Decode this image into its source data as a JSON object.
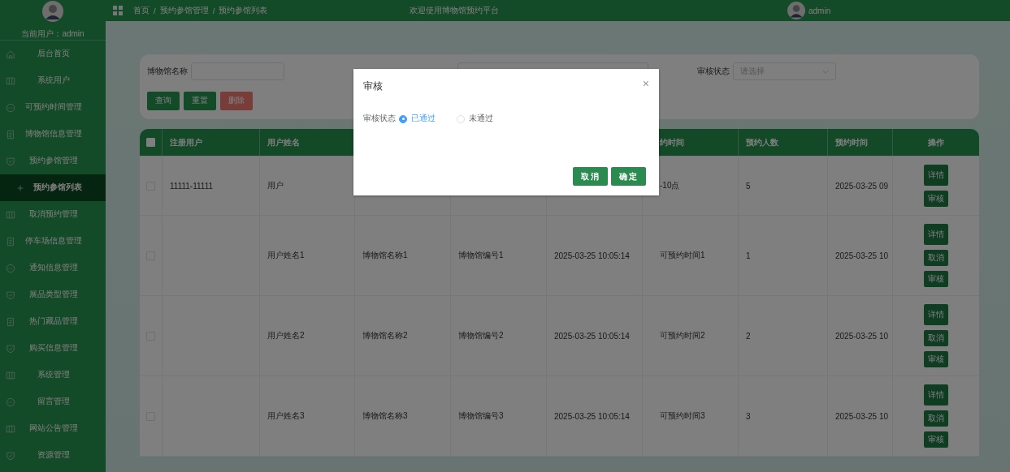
{
  "sidebar": {
    "current_user": "当前用户：admin",
    "items": [
      {
        "label": "后台首页",
        "selected": false
      },
      {
        "label": "系统用户",
        "selected": false
      },
      {
        "label": "可预约时间管理",
        "selected": false
      },
      {
        "label": "博物馆信息管理",
        "selected": false
      },
      {
        "label": "预约参馆管理",
        "selected": false
      },
      {
        "label": "预约参馆列表",
        "selected": true
      },
      {
        "label": "取消预约管理",
        "selected": false
      },
      {
        "label": "停车场信息管理",
        "selected": false
      },
      {
        "label": "通知信息管理",
        "selected": false
      },
      {
        "label": "展品类型管理",
        "selected": false
      },
      {
        "label": "热门藏品管理",
        "selected": false
      },
      {
        "label": "购买信息管理",
        "selected": false
      },
      {
        "label": "系统管理",
        "selected": false
      },
      {
        "label": "留言管理",
        "selected": false
      },
      {
        "label": "网站公告管理",
        "selected": false
      },
      {
        "label": "资源管理",
        "selected": false
      }
    ]
  },
  "topbar": {
    "breadcrumb": [
      "首页",
      "预约参馆管理",
      "预约参馆列表"
    ],
    "separator": "/",
    "welcome": "欢迎使用博物馆预约平台",
    "user": "admin"
  },
  "search": {
    "museum_label": "博物馆名称",
    "status_label": "审核状态",
    "status_placeholder": "请选择",
    "buttons": [
      {
        "label": "查询",
        "kind": "normal"
      },
      {
        "label": "重置",
        "kind": "normal"
      },
      {
        "label": "删除",
        "kind": "danger"
      }
    ]
  },
  "table": {
    "select_all_checked": false,
    "columns": {
      "registered_user": "注册用户",
      "user_name": "用户姓名",
      "slot": "约时间",
      "count": "预约人数",
      "booked_at": "预约时间",
      "actions": "操作"
    },
    "rows": [
      {
        "checked": false,
        "registered_user": "11111-11111",
        "user_name": "用户",
        "slot": "-10点",
        "count": "5",
        "booked_at": "2025-03-25 09",
        "actions": [
          {
            "label": "详情",
            "kind": "large"
          },
          {
            "label": "审核",
            "kind": "small"
          }
        ]
      },
      {
        "checked": false,
        "user_name": "用户姓名1",
        "museum_name": "博物馆名称1",
        "museum_no": "博物馆编号1",
        "time": "2025-03-25 10:05:14",
        "slot": "可预约时间1",
        "count": "1",
        "booked_at": "2025-03-25 10",
        "actions": [
          {
            "label": "详情",
            "kind": "large"
          },
          {
            "label": "取消",
            "kind": "small"
          },
          {
            "label": "审核",
            "kind": "small"
          }
        ]
      },
      {
        "checked": false,
        "user_name": "用户姓名2",
        "museum_name": "博物馆名称2",
        "museum_no": "博物馆编号2",
        "time": "2025-03-25 10:05:14",
        "slot": "可预约时间2",
        "count": "2",
        "booked_at": "2025-03-25 10",
        "actions": [
          {
            "label": "详情",
            "kind": "large"
          },
          {
            "label": "取消",
            "kind": "small"
          },
          {
            "label": "审核",
            "kind": "small"
          }
        ]
      },
      {
        "checked": false,
        "user_name": "用户姓名3",
        "museum_name": "博物馆名称3",
        "museum_no": "博物馆编号3",
        "time": "2025-03-25 10:05:14",
        "slot": "可预约时间3",
        "count": "3",
        "booked_at": "2025-03-25 10",
        "actions": [
          {
            "label": "详情",
            "kind": "large"
          },
          {
            "label": "取消",
            "kind": "small"
          },
          {
            "label": "审核",
            "kind": "small"
          }
        ]
      }
    ]
  },
  "dialog": {
    "title": "审核",
    "close": "×",
    "field_label": "审核状态",
    "options": [
      {
        "label": "已通过",
        "selected": true
      },
      {
        "label": "未通过",
        "selected": false
      }
    ],
    "buttons": [
      "取消",
      "确定"
    ]
  }
}
